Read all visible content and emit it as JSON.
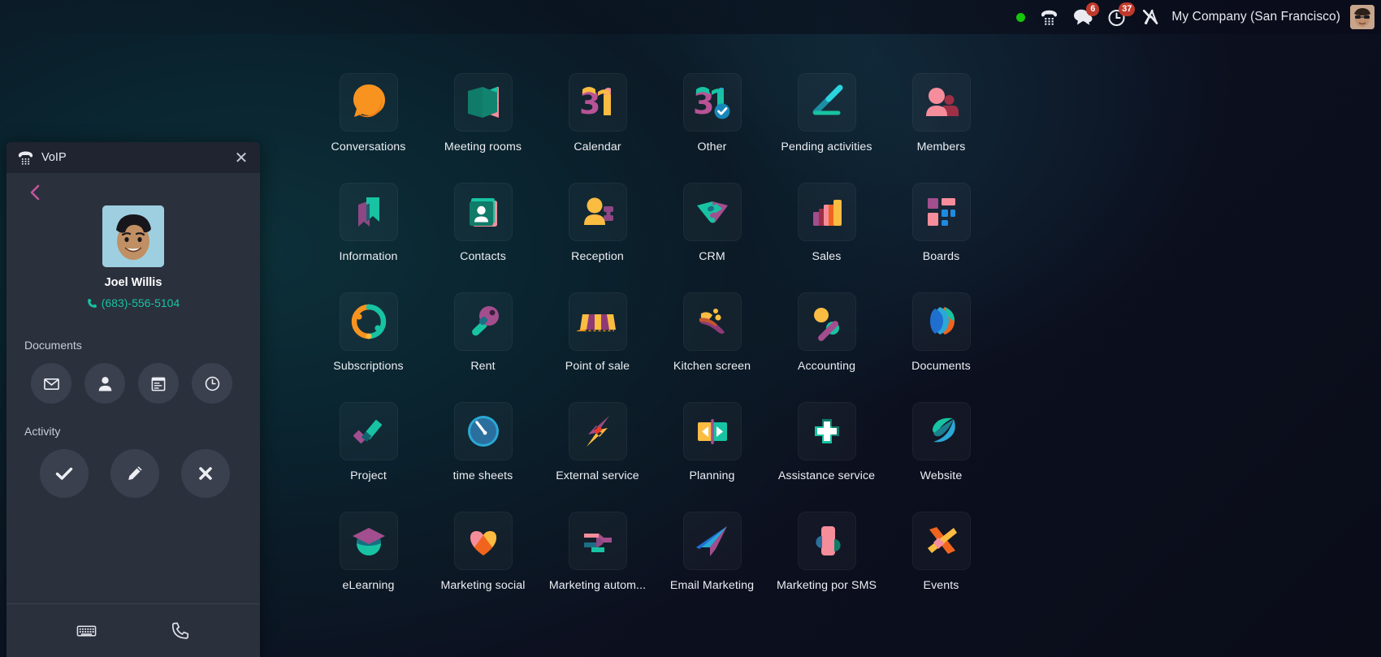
{
  "topbar": {
    "status_indicator": "online",
    "status_color": "#16c60c",
    "phone_icon": "voip-phone-icon",
    "messages_icon": "chat-bubble-icon",
    "messages_badge": "6",
    "activities_icon": "clock-icon",
    "activities_badge": "37",
    "settings_icon": "tools-icon",
    "company": "My Company (San Francisco)",
    "avatar": "user-avatar"
  },
  "voip": {
    "title": "VoIP",
    "close_label": "✕",
    "back_label": "back",
    "contact": {
      "name": "Joel Willis",
      "phone": "(683)-556-5104"
    },
    "documents_label": "Documents",
    "documents_buttons": [
      {
        "name": "email",
        "icon": "envelope-icon"
      },
      {
        "name": "contact",
        "icon": "person-icon"
      },
      {
        "name": "note",
        "icon": "notebook-icon"
      },
      {
        "name": "schedule",
        "icon": "clock-icon"
      }
    ],
    "activity_label": "Activity",
    "activity_buttons": [
      {
        "name": "mark-done",
        "icon": "check-icon"
      },
      {
        "name": "edit",
        "icon": "pencil-icon"
      },
      {
        "name": "cancel",
        "icon": "cross-icon"
      }
    ],
    "footer_buttons": [
      {
        "name": "keypad",
        "icon": "keyboard-icon"
      },
      {
        "name": "call",
        "icon": "phone-handset-icon"
      }
    ]
  },
  "apps": [
    {
      "label": "Conversations",
      "icon": "discuss-icon"
    },
    {
      "label": "Meeting rooms",
      "icon": "meeting-rooms-icon"
    },
    {
      "label": "Calendar",
      "icon": "calendar-31-icon"
    },
    {
      "label": "Other",
      "icon": "appointment-31-check-icon"
    },
    {
      "label": "Pending activities",
      "icon": "activity-arrow-icon"
    },
    {
      "label": "Members",
      "icon": "members-icon"
    },
    {
      "label": "Information",
      "icon": "knowledge-bookmark-icon"
    },
    {
      "label": "Contacts",
      "icon": "contacts-card-icon"
    },
    {
      "label": "Reception",
      "icon": "reception-person-icon"
    },
    {
      "label": "CRM",
      "icon": "crm-handshake-icon"
    },
    {
      "label": "Sales",
      "icon": "sales-bars-icon"
    },
    {
      "label": "Boards",
      "icon": "boards-squares-icon"
    },
    {
      "label": "Subscriptions",
      "icon": "subscriptions-loop-icon"
    },
    {
      "label": "Rent",
      "icon": "rent-key-icon"
    },
    {
      "label": "Point of sale",
      "icon": "pos-awning-icon"
    },
    {
      "label": "Kitchen screen",
      "icon": "kitchen-screen-icon"
    },
    {
      "label": "Accounting",
      "icon": "accounting-percent-icon"
    },
    {
      "label": "Documents",
      "icon": "documents-pages-icon"
    },
    {
      "label": "Project",
      "icon": "project-check-icon"
    },
    {
      "label": "time sheets",
      "icon": "timesheets-gauge-icon"
    },
    {
      "label": "External service",
      "icon": "field-service-bolt-icon"
    },
    {
      "label": "Planning",
      "icon": "planning-play-icon"
    },
    {
      "label": "Assistance service",
      "icon": "helpdesk-cross-icon"
    },
    {
      "label": "Website",
      "icon": "website-globe-icon"
    },
    {
      "label": "eLearning",
      "icon": "elearning-cap-icon"
    },
    {
      "label": "Marketing social",
      "icon": "social-heart-icon"
    },
    {
      "label": "Marketing autom...",
      "icon": "marketing-automation-icon"
    },
    {
      "label": "Email Marketing",
      "icon": "email-marketing-plane-icon"
    },
    {
      "label": "Marketing por SMS",
      "icon": "sms-marketing-icon"
    },
    {
      "label": "Events",
      "icon": "events-x-icon"
    }
  ],
  "colors": {
    "accent_teal": "#17c3a2",
    "accent_orange": "#f7931e",
    "accent_purple": "#9b4f8e",
    "accent_pink": "#f99",
    "badge_red": "#c0392b",
    "panel_bg": "#2b303d"
  }
}
